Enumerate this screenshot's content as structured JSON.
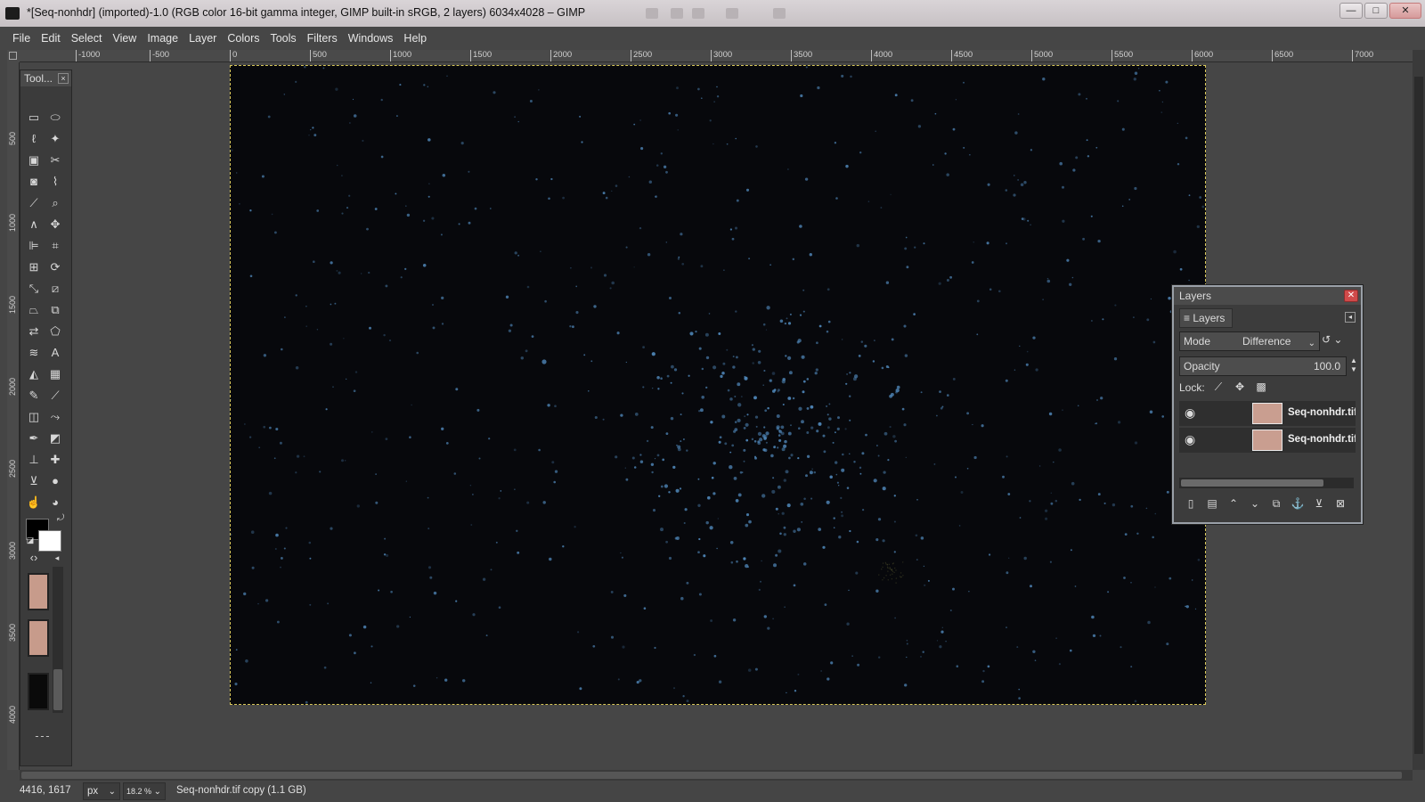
{
  "titlebar": {
    "title": "*[Seq-nonhdr] (imported)-1.0 (RGB color 16-bit gamma integer, GIMP built-in sRGB, 2 layers) 6034x4028 – GIMP"
  },
  "menubar": [
    "File",
    "Edit",
    "Select",
    "View",
    "Image",
    "Layer",
    "Colors",
    "Tools",
    "Filters",
    "Windows",
    "Help"
  ],
  "ruler_h": [
    "-1000",
    "-500",
    "0",
    "500",
    "1000",
    "1500",
    "2000",
    "2500",
    "3000",
    "3500",
    "4000",
    "4500",
    "5000",
    "5500",
    "6000",
    "6500",
    "7000"
  ],
  "ruler_v": [
    "500",
    "1000",
    "1500",
    "2000",
    "2500",
    "3000",
    "3500",
    "4000"
  ],
  "toolbox": {
    "title": "Tool...",
    "close": "×"
  },
  "layers_dialog": {
    "title": "Layers",
    "close": "✕",
    "tab": "Layers",
    "mode_label": "Mode",
    "mode_value": "Difference",
    "opacity_label": "Opacity",
    "opacity_value": "100.0",
    "lock_label": "Lock:",
    "layers": [
      {
        "name": "Seq-nonhdr.tif copy",
        "visible": true
      },
      {
        "name": "Seq-nonhdr.tif",
        "visible": true
      }
    ]
  },
  "statusbar": {
    "coords": "4416, 1617",
    "unit": "px",
    "zoom": "18.2 %",
    "message": "Seq-nonhdr.tif copy (1.1 GB)"
  },
  "colors": {
    "image_bg": "#07080c",
    "star": "#4f86b8",
    "layer_thumb": "#c99e90"
  }
}
